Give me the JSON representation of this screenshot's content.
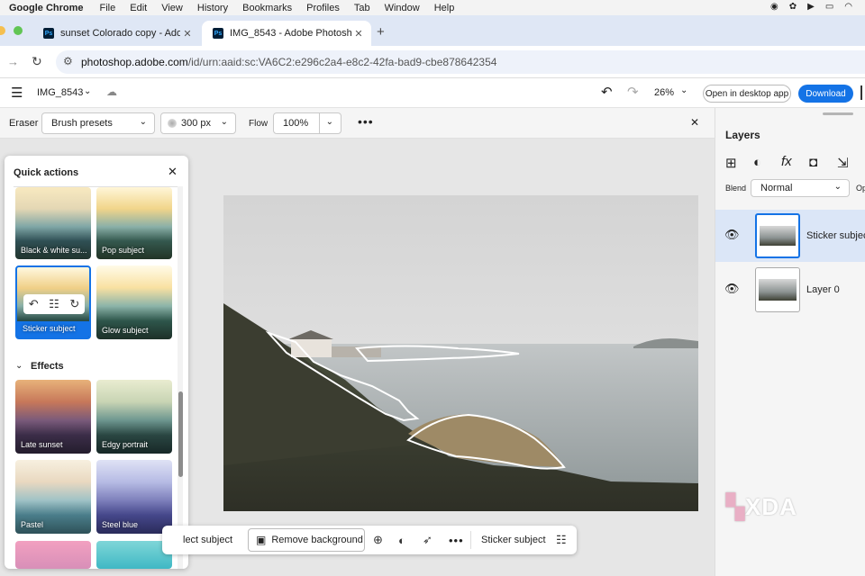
{
  "menubar": {
    "app": "Google Chrome",
    "items": [
      "File",
      "Edit",
      "View",
      "History",
      "Bookmarks",
      "Profiles",
      "Tab",
      "Window",
      "Help"
    ]
  },
  "tabs": [
    {
      "title": "sunset Colorado copy - Adob"
    },
    {
      "title": "IMG_8543 - Adobe Photosho"
    }
  ],
  "address": {
    "host": "photoshop.adobe.com",
    "path": "/id/urn:aaid:sc:VA6C2:e296c2a4-e8c2-42fa-bad9-cbe878642354"
  },
  "appbar": {
    "doc_title": "IMG_8543",
    "zoom": "26%",
    "open_desktop": "Open in desktop app",
    "download": "Download"
  },
  "options": {
    "tool": "Eraser",
    "brush_presets": "Brush presets",
    "size": "300 px",
    "flow_label": "Flow",
    "flow_value": "100%"
  },
  "quick_actions": {
    "title": "Quick actions",
    "section_effects": "Effects",
    "items": [
      "Black & white su...",
      "Pop subject",
      "Sticker subject",
      "Glow subject"
    ],
    "effects": [
      "Late sunset",
      "Edgy portrait",
      "Pastel",
      "Steel blue"
    ]
  },
  "layers": {
    "title": "Layers",
    "blend_label": "Blend",
    "blend_value": "Normal",
    "opacity_label": "Op",
    "items": [
      {
        "name": "Sticker subject"
      },
      {
        "name": "Layer 0"
      }
    ]
  },
  "taskbar": {
    "select_subject": "lect subject",
    "remove_background": "Remove background",
    "sticker_subject": "Sticker subject"
  },
  "watermark": "XDA",
  "colors": {
    "accent": "#1473e6",
    "selection": "#dbe6f7"
  }
}
